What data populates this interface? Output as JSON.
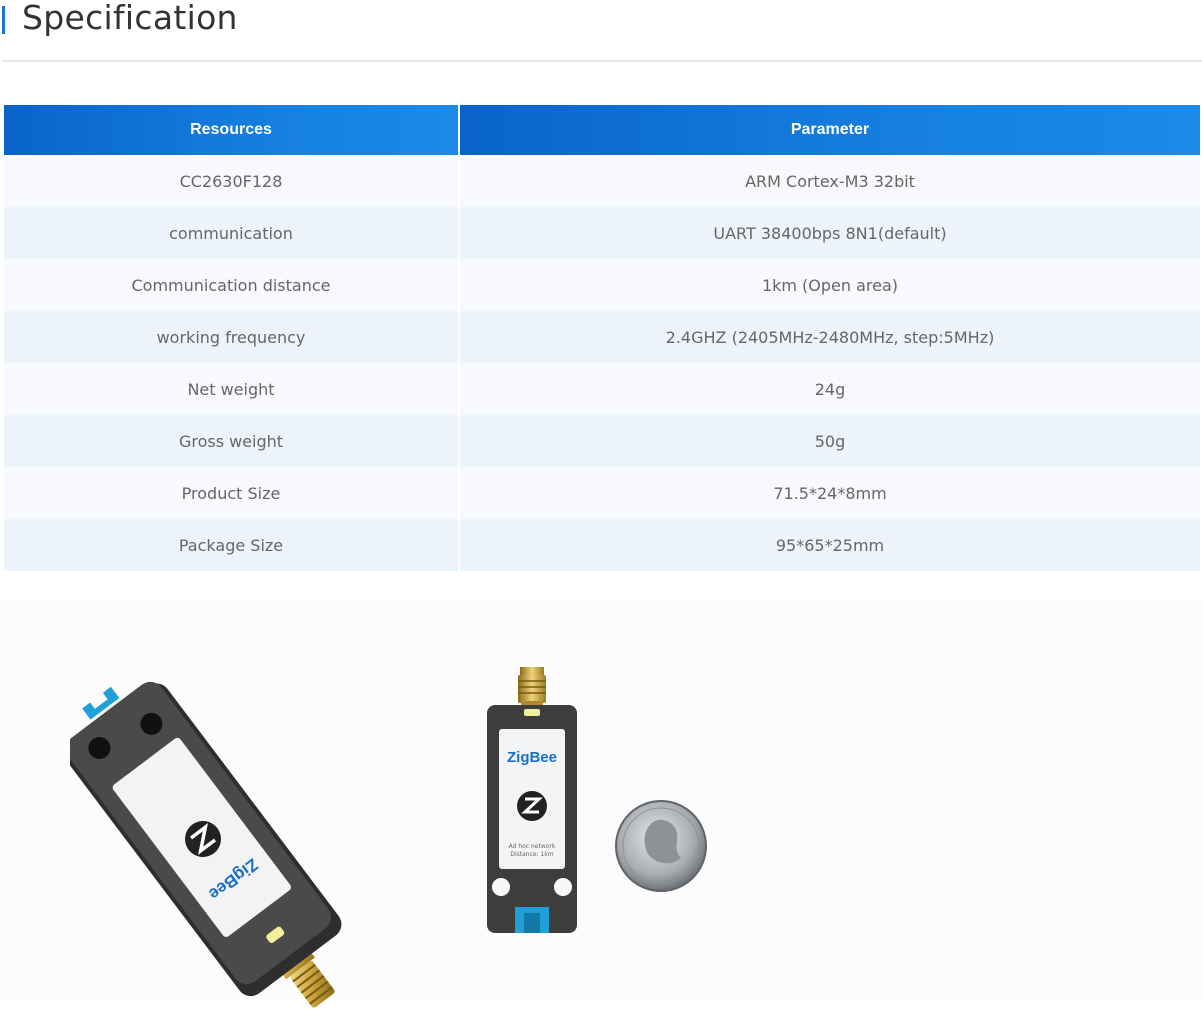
{
  "section": {
    "title": "Specification"
  },
  "table": {
    "headers": [
      "Resources",
      "Parameter"
    ],
    "rows": [
      [
        "CC2630F128",
        "ARM Cortex-M3 32bit"
      ],
      [
        "communication",
        "UART 38400bps 8N1(default)"
      ],
      [
        "Communication distance",
        "1km (Open area)"
      ],
      [
        "working frequency",
        "2.4GHZ (2405MHz-2480MHz, step:5MHz)"
      ],
      [
        "Net weight",
        "24g"
      ],
      [
        "Gross weight",
        "50g"
      ],
      [
        "Product Size",
        "71.5*24*8mm"
      ],
      [
        "Package Size",
        "95*65*25mm"
      ]
    ]
  },
  "product_label": {
    "brand": "ZigBee",
    "line1": "Ad hoc network",
    "line2": "Distance: 1km"
  },
  "colors": {
    "accent": "#1a74d0",
    "header_blue": "#1580e0",
    "label_blue": "#1a6fc7",
    "connector_blue": "#1fa0d8"
  }
}
